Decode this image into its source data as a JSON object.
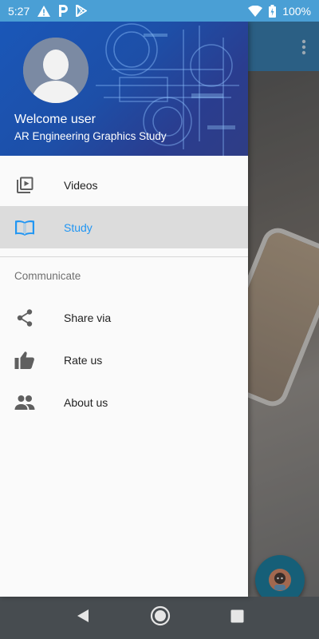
{
  "status_bar": {
    "time": "5:27",
    "battery": "100%",
    "icons": [
      "warning-icon",
      "parking-icon",
      "play-store-icon",
      "wifi-icon",
      "battery-icon"
    ]
  },
  "drawer": {
    "header": {
      "welcome": "Welcome user",
      "app_name": "AR Engineering Graphics Study"
    },
    "items": [
      {
        "label": "Videos",
        "icon": "video-library-icon",
        "active": false
      },
      {
        "label": "Study",
        "icon": "book-icon",
        "active": true
      }
    ],
    "section_title": "Communicate",
    "communicate_items": [
      {
        "label": "Share via",
        "icon": "share-icon"
      },
      {
        "label": "Rate us",
        "icon": "thumb-up-icon"
      },
      {
        "label": "About us",
        "icon": "people-icon"
      }
    ]
  },
  "colors": {
    "status_bar": "#4a9fd5",
    "accent": "#2196f3",
    "header": "#1d4fa8",
    "nav_bar": "#474c50",
    "fab": "#1e7fa0"
  },
  "nav_bar": {
    "buttons": [
      "back-icon",
      "home-icon",
      "recents-icon"
    ]
  }
}
